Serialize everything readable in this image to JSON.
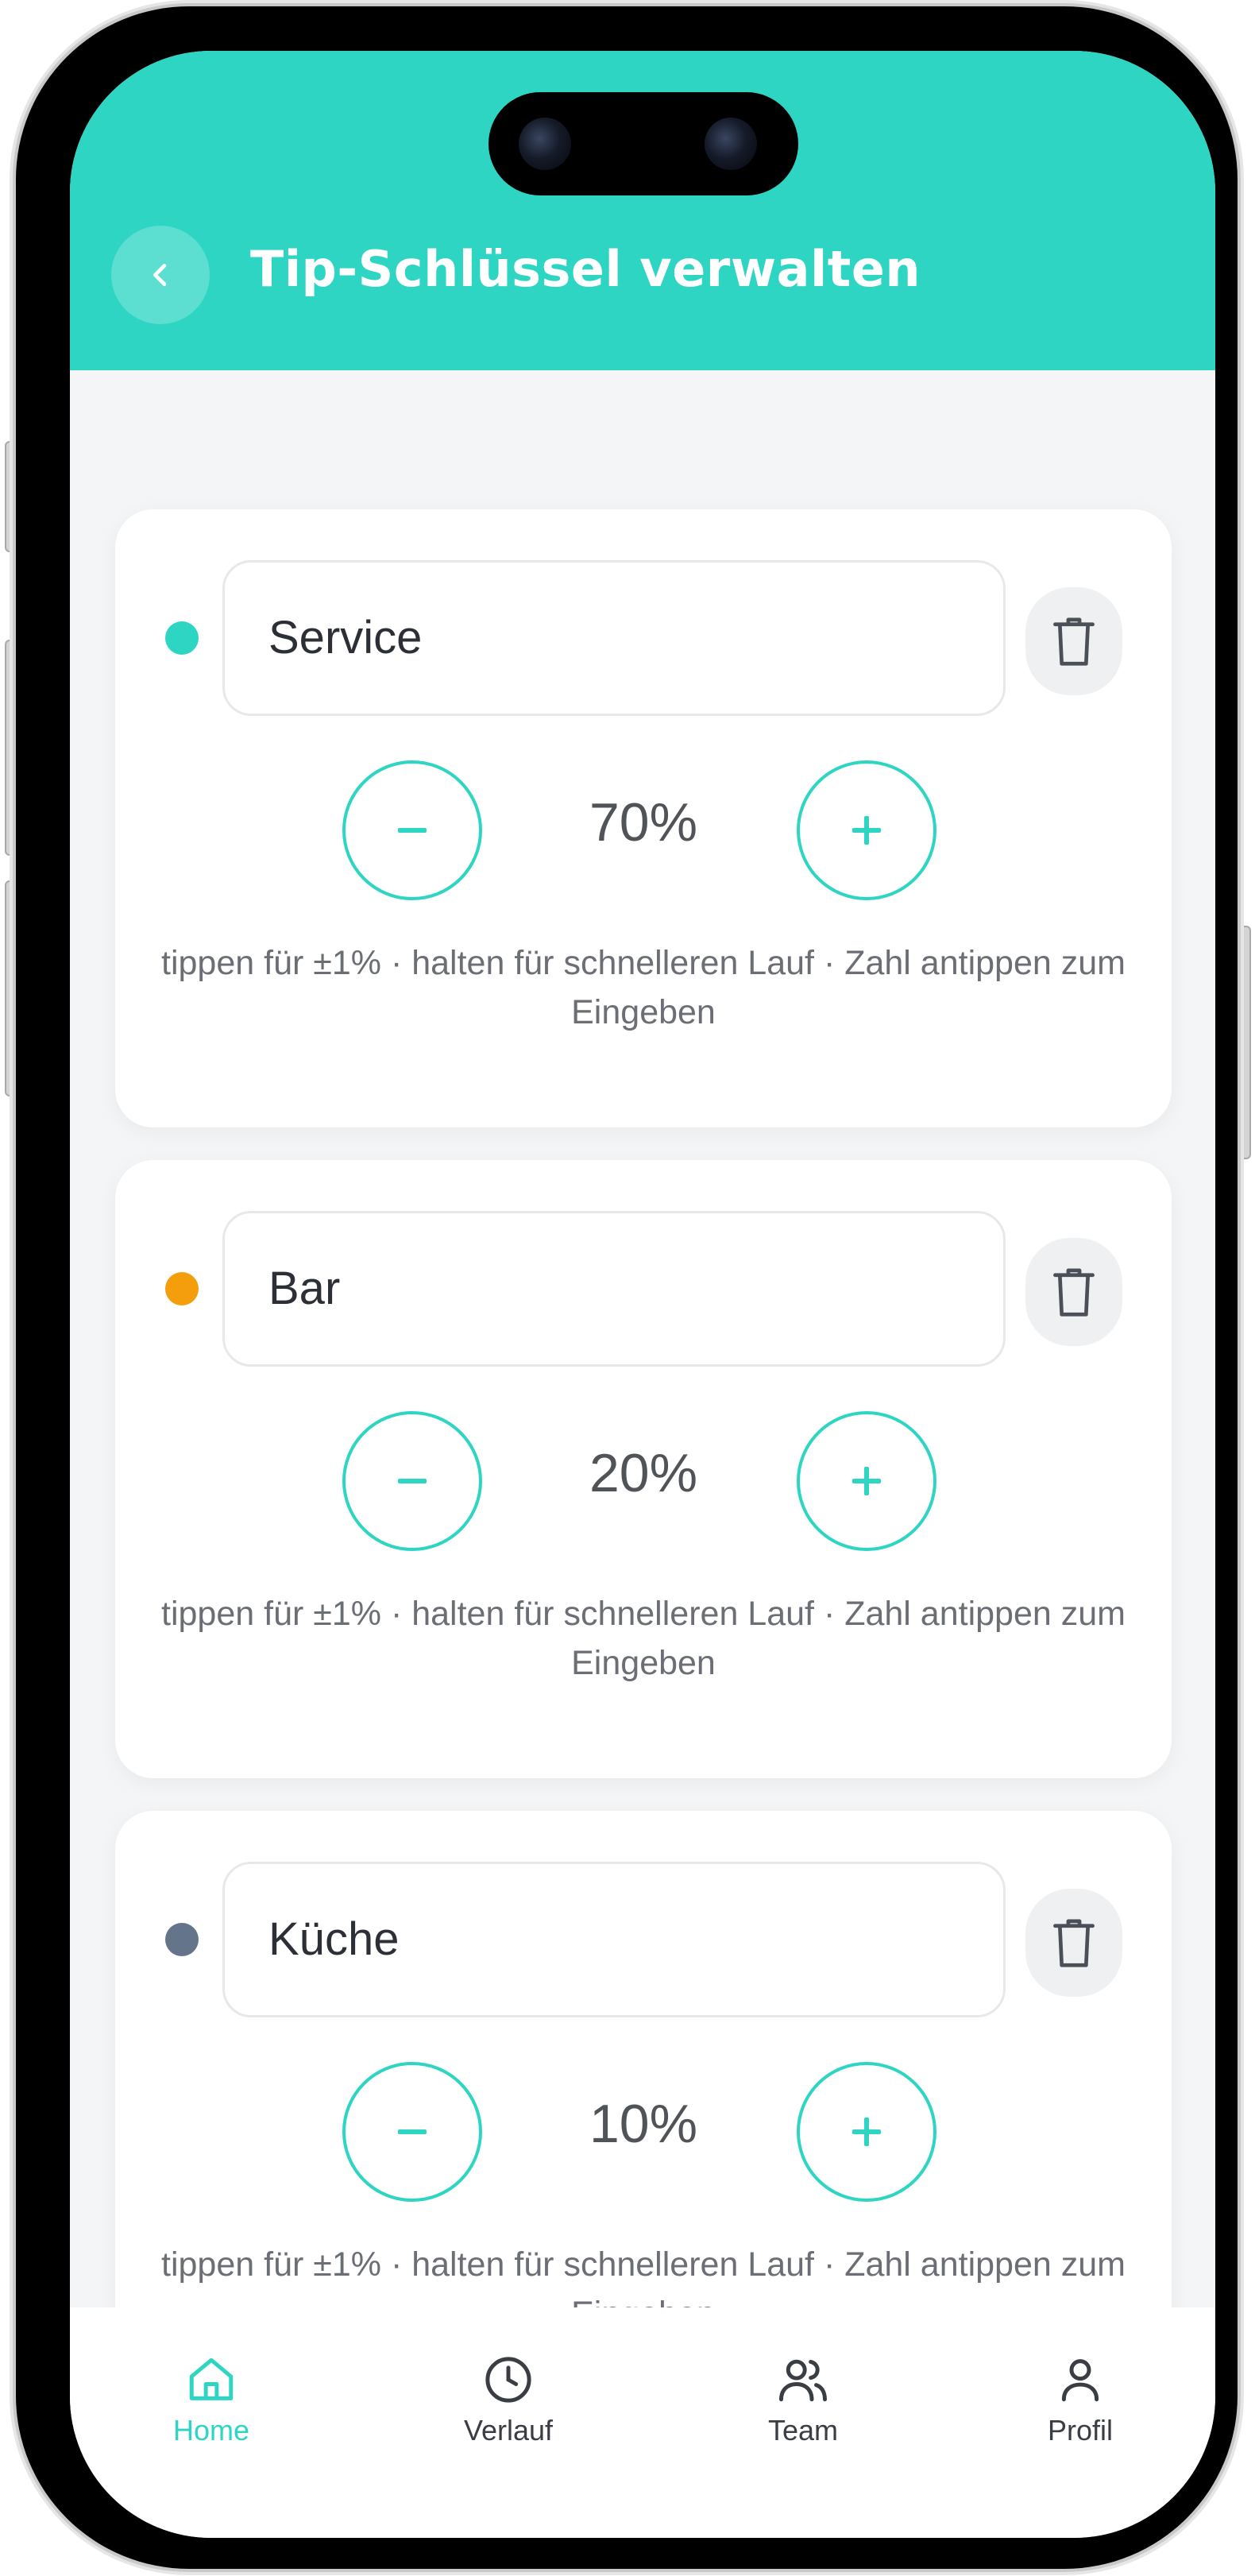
{
  "header": {
    "title": "Tip-Schlüssel verwalten"
  },
  "keys": [
    {
      "name": "Service",
      "percent": "70%",
      "dot_color": "#2fd5c3"
    },
    {
      "name": "Bar",
      "percent": "20%",
      "dot_color": "#f59e0b"
    },
    {
      "name": "Küche",
      "percent": "10%",
      "dot_color": "#64748b"
    }
  ],
  "hint_text": "tippen für ±1% · halten für schnelleren Lauf · Zahl antippen zum Eingeben",
  "tabbar": {
    "items": [
      {
        "label": "Home",
        "icon": "home-icon",
        "active": true
      },
      {
        "label": "Verlauf",
        "icon": "clock-icon",
        "active": false
      },
      {
        "label": "Team",
        "icon": "users-icon",
        "active": false
      },
      {
        "label": "Profil",
        "icon": "user-icon",
        "active": false
      }
    ]
  },
  "colors": {
    "accent": "#2fd5c3",
    "text_dark": "#2c2f36",
    "text_muted": "#6b6e74"
  }
}
